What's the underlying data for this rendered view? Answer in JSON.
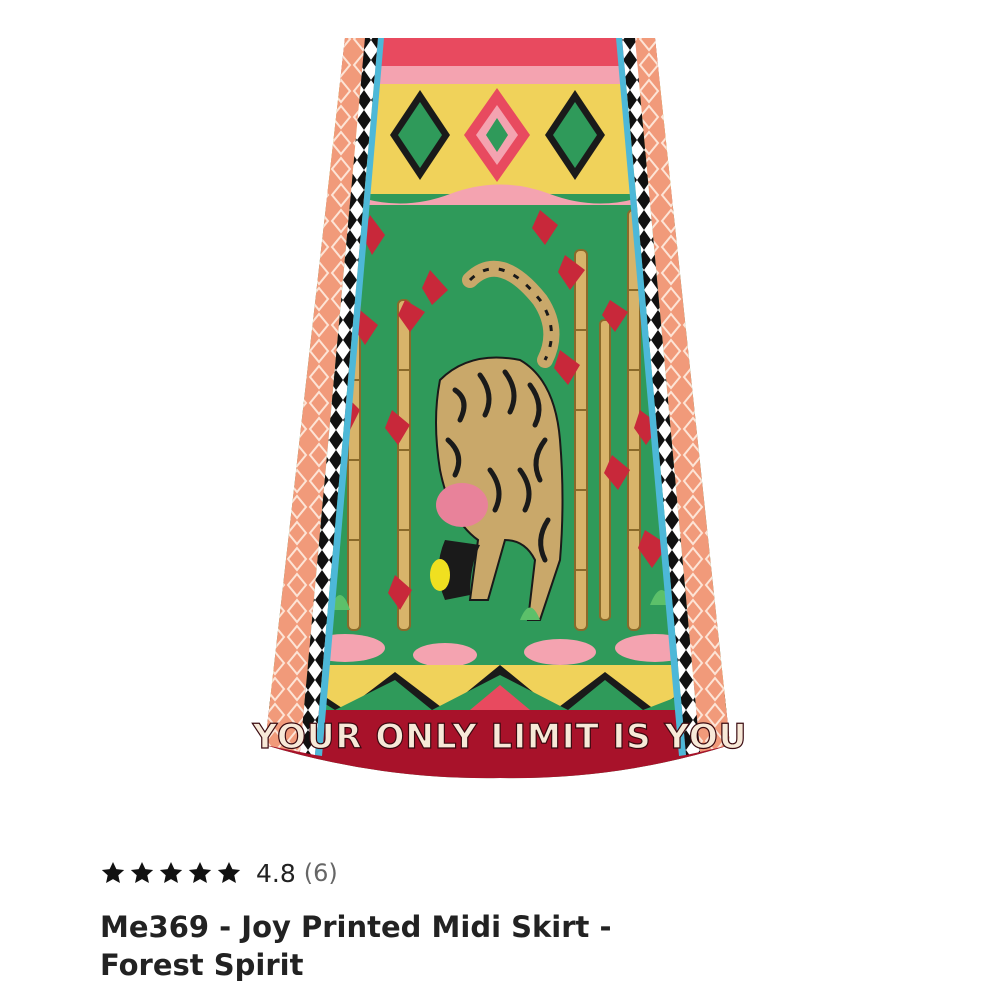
{
  "product": {
    "image_alt": "Printed midi skirt with tiger and bamboo forest print",
    "print_text": "YOUR ONLY LIMIT IS YOU",
    "rating": {
      "stars_filled": 5,
      "stars_total": 5,
      "value": "4.8",
      "count": "(6)"
    },
    "title": "Me369 - Joy Printed Midi Skirt - Forest Spirit"
  },
  "colors": {
    "background": "#ffffff",
    "skirt_green": "#2f9a5a",
    "border_coral": "#f19a7a",
    "hem_red": "#a8122a",
    "accent_yellow": "#f0d25a",
    "title_text": "#222222",
    "count_text": "#666666",
    "star": "#111111"
  },
  "icons": [
    "star-icon"
  ]
}
